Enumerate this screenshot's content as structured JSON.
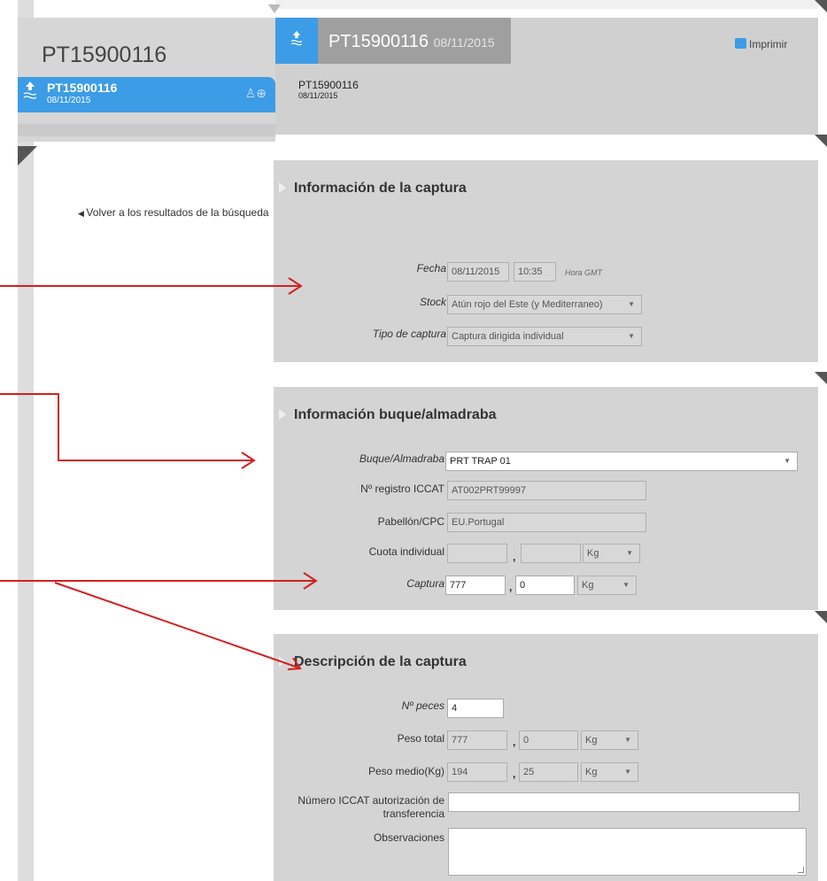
{
  "record": {
    "title": "PT15900116",
    "item_name": "PT15900116",
    "item_date": "08/11/2015"
  },
  "nav": {
    "back_link": "Volver a los resultados de la búsqueda"
  },
  "header": {
    "title": "PT15900116",
    "title_date": "08/11/2015",
    "sub_name": "PT15900116",
    "sub_date": "08/11/2015",
    "print_label": "Imprimir"
  },
  "captura_info": {
    "heading": "Información de la captura",
    "fecha_label": "Fecha",
    "fecha_value": "08/11/2015",
    "hora_value": "10:35",
    "hora_hint": "Hora GMT",
    "stock_label": "Stock",
    "stock_value": "Atún rojo del Este (y Mediterraneo)",
    "tipo_label": "Tipo de captura",
    "tipo_value": "Captura dirigida individual"
  },
  "buque_info": {
    "heading": "Información buque/almadraba",
    "buque_label": "Buque/Almadraba",
    "buque_value": "PRT TRAP 01",
    "registro_label": "Nº registro ICCAT",
    "registro_value": "AT002PRT99997",
    "pabellon_label": "Pabellón/CPC",
    "pabellon_value": "EU.Portugal",
    "cuota_label": "Cuota individual",
    "cuota_int": "",
    "cuota_dec": "",
    "cuota_unit": "Kg",
    "captura_label": "Captura",
    "captura_int": "777",
    "captura_dec": "0",
    "captura_unit": "Kg",
    "comma": ","
  },
  "descripcion": {
    "heading": "Descripción de la captura",
    "peces_label": "Nº peces",
    "peces_value": "4",
    "peso_total_label": "Peso total",
    "peso_total_int": "777",
    "peso_total_dec": "0",
    "peso_total_unit": "Kg",
    "peso_medio_label": "Peso medio(Kg)",
    "peso_medio_int": "194",
    "peso_medio_dec": "25",
    "peso_medio_unit": "Kg",
    "numero_label_1": "Número ICCAT autorización de",
    "numero_label_2": "transferencia",
    "numero_value": "",
    "observaciones_label": "Observaciones",
    "observaciones_value": ""
  },
  "colors": {
    "accent": "#3d9ce6",
    "annotation_arrow": "#d42020",
    "section_bg": "#d4d4d4"
  }
}
